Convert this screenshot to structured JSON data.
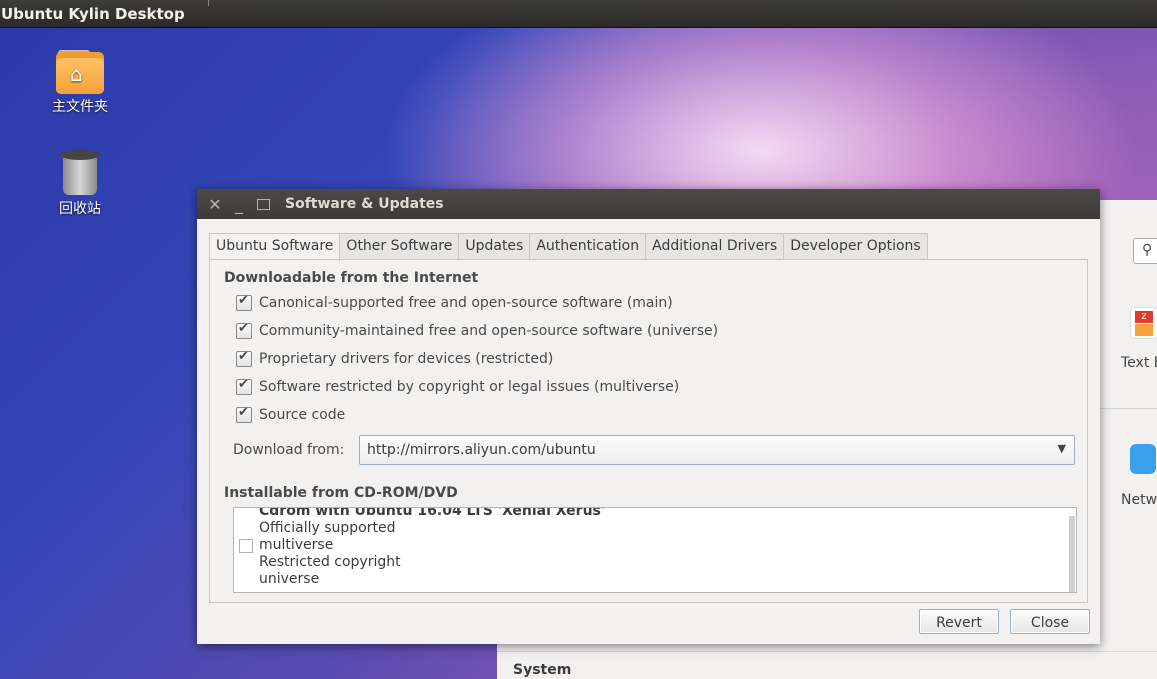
{
  "panel": {
    "title": "Ubuntu Kylin Desktop"
  },
  "desktop": {
    "icons": [
      {
        "label": "主文件夹",
        "icon": "home-folder-icon"
      },
      {
        "label": "回收站",
        "icon": "trash-icon"
      }
    ]
  },
  "background_window": {
    "apps": [
      {
        "label": "Text E",
        "icon": "text-editor-icon"
      },
      {
        "label": "Netw",
        "icon": "network-icon"
      }
    ],
    "section": "System"
  },
  "dialog": {
    "title": "Software & Updates",
    "tabs": [
      "Ubuntu Software",
      "Other Software",
      "Updates",
      "Authentication",
      "Additional Drivers",
      "Developer Options"
    ],
    "active_tab": "Ubuntu Software",
    "downloadable": {
      "heading": "Downloadable from the Internet",
      "options": [
        {
          "label": "Canonical-supported free and open-source software (main)",
          "checked": true
        },
        {
          "label": "Community-maintained free and open-source software (universe)",
          "checked": true
        },
        {
          "label": "Proprietary drivers for devices (restricted)",
          "checked": true
        },
        {
          "label": "Software restricted by copyright or legal issues (multiverse)",
          "checked": true
        },
        {
          "label": "Source code",
          "checked": true
        }
      ],
      "download_from_label": "Download from:",
      "download_from_value": "http://mirrors.aliyun.com/ubuntu"
    },
    "cdrom": {
      "heading": "Installable from CD-ROM/DVD",
      "entry": {
        "title": "Cdrom with Ubuntu 16.04 LTS 'Xenial Xerus'",
        "lines": [
          "Officially supported",
          "multiverse",
          "Restricted copyright",
          "universe"
        ],
        "checked": false
      }
    },
    "buttons": {
      "revert": "Revert",
      "close": "Close"
    }
  }
}
